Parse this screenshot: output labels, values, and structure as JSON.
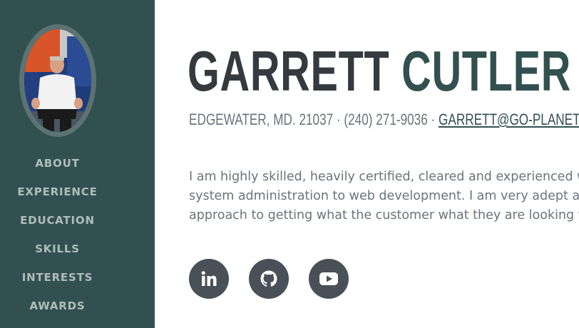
{
  "sidebar": {
    "avatar_alt": "Garrett Cutler profile photo",
    "nav": [
      {
        "label": "ABOUT"
      },
      {
        "label": "EXPERIENCE"
      },
      {
        "label": "EDUCATION"
      },
      {
        "label": "SKILLS"
      },
      {
        "label": "INTERESTS"
      },
      {
        "label": "AWARDS"
      }
    ]
  },
  "header": {
    "first_name": "GARRETT",
    "last_name": "CUTLER"
  },
  "contact": {
    "address": "EDGEWATER, MD. 21037",
    "separator": " · ",
    "phone": "(240) 271-9036",
    "email": "GARRETT@GO-PLANET.COM"
  },
  "bio": {
    "lines": [
      "I am highly skilled, heavily certified, cleared and experienced with",
      "system administration to web development. I am very adept at le",
      "approach to getting what the customer what they are looking for"
    ]
  },
  "social": [
    {
      "name": "linkedin",
      "icon": "linkedin-icon"
    },
    {
      "name": "github",
      "icon": "github-icon"
    },
    {
      "name": "youtube",
      "icon": "youtube-icon"
    }
  ],
  "colors": {
    "sidebar_bg": "#32504f",
    "accent": "#32504f",
    "name_dark": "#353a3f",
    "text_muted": "#6c737b",
    "nav_text": "#aebdbc",
    "social_bg": "#495057"
  }
}
